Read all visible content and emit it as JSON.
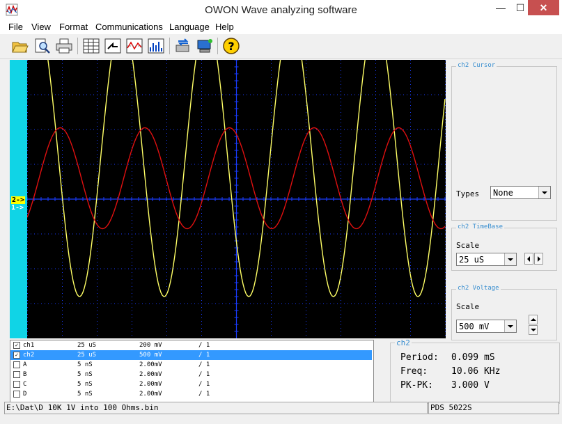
{
  "window": {
    "title": "OWON Wave analyzing software",
    "min": "—",
    "max": "☐",
    "close": "✕"
  },
  "menu": [
    "File",
    "View",
    "Format",
    "Communications",
    "Language",
    "Help"
  ],
  "colors": {
    "scope_bg": "#000000",
    "grid": "#1a3cff",
    "ch1": "#ffff66",
    "ch2": "#e01010",
    "gutter": "#10d4e6"
  },
  "scope": {
    "markers": {
      "ch2": "2->",
      "ch1": "1->"
    },
    "traces": [
      {
        "name": "ch1",
        "color": "#ffff66",
        "amplitude_div": 4.0,
        "offset_div": 1.2,
        "period_div": 2.43,
        "phase_x_div": 0.29
      },
      {
        "name": "ch2",
        "color": "#e01010",
        "amplitude_div": 1.45,
        "offset_div": 0.6,
        "period_div": 2.43,
        "phase_x_div": 0.95
      }
    ]
  },
  "channels": [
    {
      "checked": true,
      "name": "ch1",
      "time": "25 uS",
      "volt": "200 mV",
      "ratio": "/ 1",
      "selected": false
    },
    {
      "checked": true,
      "name": "ch2",
      "time": "25 uS",
      "volt": "500 mV",
      "ratio": "/ 1",
      "selected": true
    },
    {
      "checked": false,
      "name": "A",
      "time": "5  nS",
      "volt": "2.00mV",
      "ratio": "/ 1",
      "selected": false
    },
    {
      "checked": false,
      "name": "B",
      "time": "5  nS",
      "volt": "2.00mV",
      "ratio": "/ 1",
      "selected": false
    },
    {
      "checked": false,
      "name": "C",
      "time": "5  nS",
      "volt": "2.00mV",
      "ratio": "/ 1",
      "selected": false
    },
    {
      "checked": false,
      "name": "D",
      "time": "5  nS",
      "volt": "2.00mV",
      "ratio": "/ 1",
      "selected": false
    }
  ],
  "cursor": {
    "title": "ch2 Cursor",
    "types_label": "Types",
    "types_value": "None"
  },
  "timebase": {
    "title": "ch2 TimeBase",
    "scale_label": "Scale",
    "scale_value": "25 uS"
  },
  "voltage": {
    "title": "ch2 Voltage",
    "scale_label": "Scale",
    "scale_value": "500 mV"
  },
  "info": {
    "title": "ch2",
    "period_label": "Period:",
    "period_value": "0.099 mS",
    "freq_label": "Freq:",
    "freq_value": "10.06 KHz",
    "pkpk_label": "PK-PK:",
    "pkpk_value": "3.000 V"
  },
  "status": {
    "file": "E:\\Dat\\D 10K 1V into 100 Ohms.bin",
    "model": "PDS 5022S"
  },
  "toolbar_icons": [
    "open-folder-icon",
    "print-preview-icon",
    "print-icon",
    "data-table-icon",
    "export-icon",
    "waveform-icon",
    "spectrum-icon",
    "transfer-icon",
    "device-icon",
    "help-icon"
  ]
}
